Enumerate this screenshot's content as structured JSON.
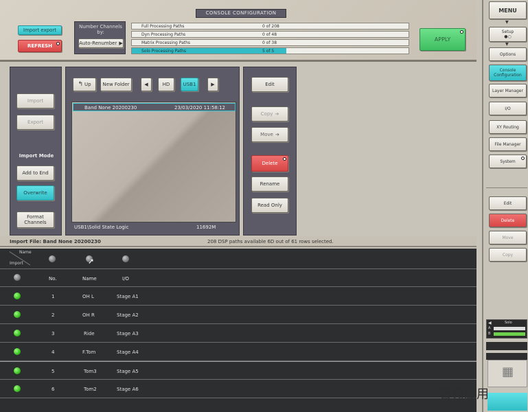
{
  "header": {
    "title": "CONSOLE CONFIGURATION"
  },
  "top": {
    "import_export_label": "Import export",
    "refresh_label": "REFRESH",
    "number_channels_label": "Number Channels by:",
    "auto_renumber_label": "Auto-Renumber",
    "apply_label": "APPLY",
    "processing": [
      {
        "label": "Full Processing Paths",
        "value": "0 of 208",
        "fill": 0
      },
      {
        "label": "Dyn Processing Paths",
        "value": "0 of 48",
        "fill": 0
      },
      {
        "label": "Matrix Processing Paths",
        "value": "0 of 38",
        "fill": 0
      },
      {
        "label": "Solo Processing Paths",
        "value": "5 of 5",
        "fill": 1.0
      }
    ]
  },
  "left_panel": {
    "import_label": "Import",
    "export_label": "Export",
    "import_mode_label": "Import Mode",
    "add_to_end_label": "Add to End",
    "overwrite_label": "Overwrite",
    "format_channels_label": "Format Channels"
  },
  "browser": {
    "up_label": "Up",
    "new_folder_label": "New Folder",
    "hd_label": "HD",
    "usb_label": "USB1",
    "file_name": "Band None 20200230",
    "file_date": "23/03/2020 11:58:12",
    "path": "USB1\\Solid State Logic",
    "free_space": "11692M"
  },
  "actions": {
    "edit_label": "Edit",
    "copy_label": "Copy",
    "move_label": "Move",
    "delete_label": "Delete",
    "rename_label": "Rename",
    "read_only_label": "Read Only"
  },
  "status": {
    "import_file": "Import File: Band None 20200230",
    "paths_info": "208 DSP paths available 6D out of 61 rows selected."
  },
  "table": {
    "corner_top": "Name",
    "corner_bottom": "Import",
    "headers": [
      "No.",
      "Name",
      "I/O"
    ],
    "rows": [
      {
        "no": "1",
        "name": "OH L",
        "io": "Stage A1"
      },
      {
        "no": "2",
        "name": "OH R",
        "io": "Stage A2"
      },
      {
        "no": "3",
        "name": "Ride",
        "io": "Stage A3"
      },
      {
        "no": "4",
        "name": "F.Tom",
        "io": "Stage A4"
      },
      {
        "no": "5",
        "name": "Tom3",
        "io": "Stage A5"
      },
      {
        "no": "6",
        "name": "Tom2",
        "io": "Stage A6"
      }
    ]
  },
  "right": {
    "menu_label": "MENU",
    "setup_label": "Setup",
    "options_label": "Options",
    "console_config_label": "Console Configuration",
    "layer_manager_label": "Layer Manager",
    "io_label": "I/O",
    "xy_routing_label": "XY Routing",
    "file_manager_label": "File Manager",
    "system_label": "System",
    "edit_label": "Edit",
    "delete_label": "Delete",
    "move_label": "Move",
    "copy_label": "Copy",
    "solo_label": "Solo",
    "meter_a": "A",
    "meter_b": "B"
  },
  "watermark": "音频应用"
}
